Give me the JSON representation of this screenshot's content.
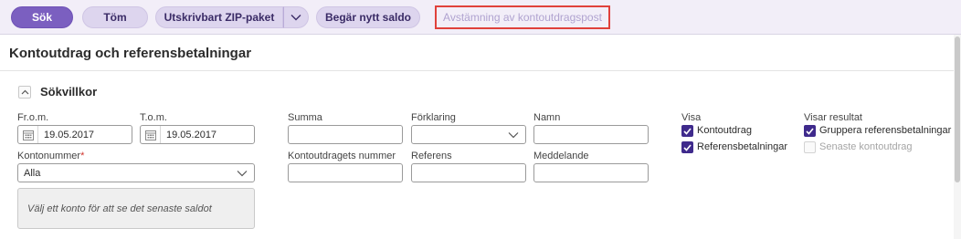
{
  "toolbar": {
    "search_label": "Sök",
    "clear_label": "Töm",
    "zip_label": "Utskrivbart ZIP-paket",
    "request_balance_label": "Begär nytt saldo",
    "reconcile_label": "Avstämning av kontoutdragspost"
  },
  "page": {
    "title": "Kontoutdrag och referensbetalningar"
  },
  "criteria": {
    "section_title": "Sökvillkor",
    "from_label": "Fr.o.m.",
    "from_value": "19.05.2017",
    "to_label": "T.o.m.",
    "to_value": "19.05.2017",
    "account_label": "Kontonummer",
    "account_required": "*",
    "account_value": "Alla",
    "info_text": "Välj ett konto för att se det senaste saldot",
    "sum_label": "Summa",
    "explanation_label": "Förklaring",
    "name_label": "Namn",
    "statement_number_label": "Kontoutdragets nummer",
    "reference_label": "Referens",
    "message_label": "Meddelande"
  },
  "show": {
    "label": "Visa",
    "options": [
      {
        "label": "Kontoutdrag",
        "checked": true
      },
      {
        "label": "Referensbetalningar",
        "checked": true
      }
    ]
  },
  "results": {
    "label": "Visar resultat",
    "options": [
      {
        "label": "Gruppera referensbetalningar",
        "checked": true,
        "enabled": true
      },
      {
        "label": "Senaste kontoutdrag",
        "checked": false,
        "enabled": false
      }
    ]
  },
  "colors": {
    "primary": "#7b5fc0",
    "secondary": "#ddd5ee",
    "checkbox": "#3f2a8c",
    "highlight_border": "#e0413b"
  }
}
